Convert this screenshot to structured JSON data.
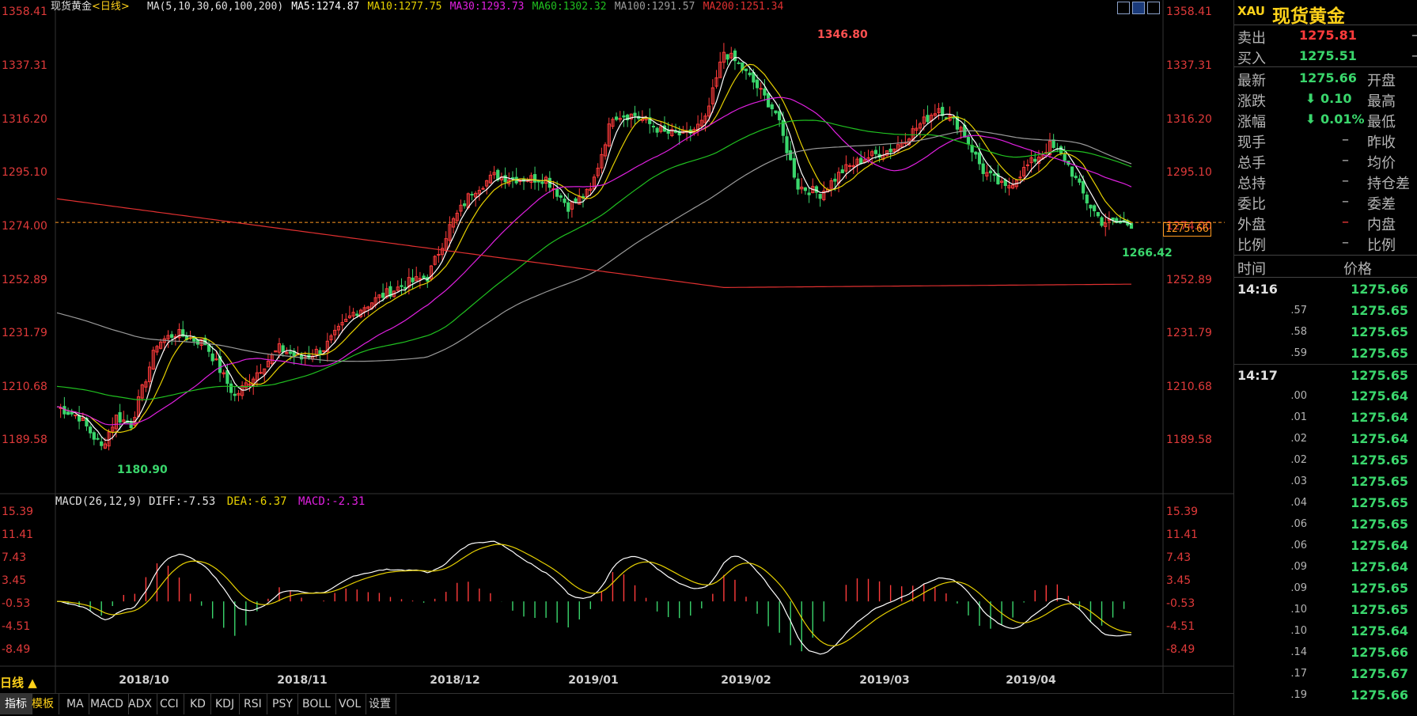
{
  "header": {
    "instrument": "现货黄金",
    "period": "<日线>",
    "ma_params": "MA(5,10,30,60,100,200)",
    "ma5": "MA5:1274.87",
    "ma10": "MA10:1277.75",
    "ma30": "MA30:1293.73",
    "ma60": "MA60:1302.32",
    "ma100": "MA100:1291.57",
    "ma200": "MA200:1251.34"
  },
  "colors": {
    "up": "#ff3b3b",
    "down": "#3ad66c",
    "ma5": "#ffffff",
    "ma10": "#e6d000",
    "ma30": "#e020e0",
    "ma60": "#20c020",
    "ma100": "#9a9a9a",
    "ma200": "#e03030",
    "axis_text": "#e03a3a"
  },
  "price_axis": {
    "ticks": [
      "1358.41",
      "1337.31",
      "1316.20",
      "1295.10",
      "1274.00",
      "1252.89",
      "1231.79",
      "1210.68",
      "1189.58"
    ],
    "current_price_label": "1275.66",
    "high_label": "1346.80",
    "low_label": "1180.90",
    "recent_low_label": "1266.42"
  },
  "macd": {
    "title": "MACD(26,12,9)",
    "diff": "DIFF:-7.53",
    "dea": "DEA:-6.37",
    "macd": "MACD:-2.31",
    "ticks": [
      "15.39",
      "11.41",
      "7.43",
      "3.45",
      "-0.53",
      "-4.51",
      "-8.49"
    ]
  },
  "x_axis": {
    "labels": [
      "2018/10",
      "2018/11",
      "2018/12",
      "2019/01",
      "2019/02",
      "2019/03",
      "2019/04"
    ]
  },
  "chart_data": {
    "type": "candlestick",
    "series": [
      {
        "name": "MA5",
        "value": 1274.87
      },
      {
        "name": "MA10",
        "value": 1277.75
      },
      {
        "name": "MA30",
        "value": 1293.73
      },
      {
        "name": "MA60",
        "value": 1302.32
      },
      {
        "name": "MA100",
        "value": 1291.57
      },
      {
        "name": "MA200",
        "value": 1251.34
      }
    ],
    "ylim": [
      1180.9,
      1358.41
    ],
    "macd_ylim": [
      -8.49,
      15.39
    ],
    "period_high": 1346.8,
    "period_low": 1180.9,
    "last": 1275.66
  },
  "bottom": {
    "period_label": "日线 ▲",
    "tabs": [
      "指标",
      "模板",
      "MA",
      "MACD",
      "ADX",
      "CCI",
      "KD",
      "KDJ",
      "RSI",
      "PSY",
      "BOLL",
      "VOL",
      "设置"
    ]
  },
  "sidebar": {
    "code": "XAU",
    "name": "现货黄金",
    "sell_label": "卖出",
    "sell_value": "1275.81",
    "buy_label": "买入",
    "buy_value": "1275.51",
    "stats": [
      {
        "l": "最新",
        "v": "1275.66",
        "r": "开盘"
      },
      {
        "l": "涨跌",
        "v": "⬇ 0.10",
        "r": "最高"
      },
      {
        "l": "涨幅",
        "v": "⬇ 0.01%",
        "r": "最低"
      },
      {
        "l": "现手",
        "v": "–",
        "r": "昨收"
      },
      {
        "l": "总手",
        "v": "–",
        "r": "均价"
      },
      {
        "l": "总持",
        "v": "–",
        "r": "持仓差"
      },
      {
        "l": "委比",
        "v": "–",
        "r": "委差"
      },
      {
        "l": "外盘",
        "v": "–",
        "r": "内盘"
      },
      {
        "l": "比例",
        "v": "–",
        "r": "比例"
      }
    ],
    "ticks_header_time": "时间",
    "ticks_header_price": "价格",
    "ticks": [
      {
        "t": "14:16",
        "p": "1275.66",
        "big": true
      },
      {
        "t": ".57",
        "p": "1275.65"
      },
      {
        "t": ".58",
        "p": "1275.65"
      },
      {
        "t": ".59",
        "p": "1275.65"
      },
      {
        "t": "14:17",
        "p": "1275.65",
        "big": true
      },
      {
        "t": ".00",
        "p": "1275.64"
      },
      {
        "t": ".01",
        "p": "1275.64"
      },
      {
        "t": ".02",
        "p": "1275.64"
      },
      {
        "t": ".02",
        "p": "1275.65"
      },
      {
        "t": ".03",
        "p": "1275.65"
      },
      {
        "t": ".04",
        "p": "1275.65"
      },
      {
        "t": ".06",
        "p": "1275.65"
      },
      {
        "t": ".06",
        "p": "1275.64"
      },
      {
        "t": ".09",
        "p": "1275.64"
      },
      {
        "t": ".09",
        "p": "1275.65"
      },
      {
        "t": ".10",
        "p": "1275.65"
      },
      {
        "t": ".10",
        "p": "1275.64"
      },
      {
        "t": ".14",
        "p": "1275.66"
      },
      {
        "t": ".17",
        "p": "1275.67"
      },
      {
        "t": ".19",
        "p": "1275.66"
      }
    ]
  }
}
